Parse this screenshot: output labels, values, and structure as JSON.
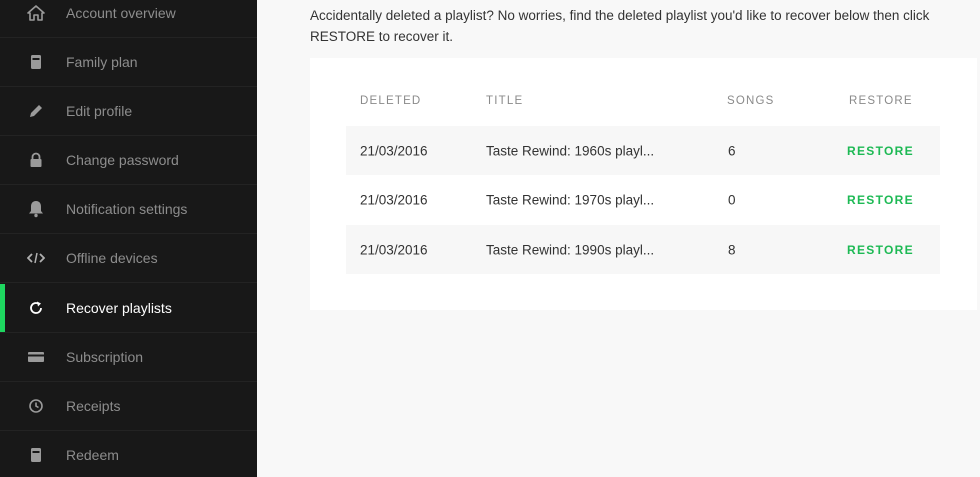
{
  "sidebar": {
    "items": [
      {
        "label": "Account overview",
        "icon": "home-icon"
      },
      {
        "label": "Family plan",
        "icon": "device-icon"
      },
      {
        "label": "Edit profile",
        "icon": "pencil-icon"
      },
      {
        "label": "Change password",
        "icon": "lock-icon"
      },
      {
        "label": "Notification settings",
        "icon": "bell-icon"
      },
      {
        "label": "Offline devices",
        "icon": "code-icon"
      },
      {
        "label": "Recover playlists",
        "icon": "refresh-icon",
        "active": true
      },
      {
        "label": "Subscription",
        "icon": "card-icon"
      },
      {
        "label": "Receipts",
        "icon": "clock-icon"
      },
      {
        "label": "Redeem",
        "icon": "device-icon"
      }
    ]
  },
  "main": {
    "intro": "Accidentally deleted a playlist? No worries, find the deleted playlist you'd like to recover below then click RESTORE to recover it.",
    "table": {
      "headers": [
        "DELETED",
        "TITLE",
        "SONGS",
        "RESTORE"
      ],
      "rows": [
        {
          "deleted": "21/03/2016",
          "title": "Taste Rewind: 1960s playl...",
          "songs": "6",
          "action": "RESTORE"
        },
        {
          "deleted": "21/03/2016",
          "title": "Taste Rewind: 1970s playl...",
          "songs": "0",
          "action": "RESTORE"
        },
        {
          "deleted": "21/03/2016",
          "title": "Taste Rewind: 1990s playl...",
          "songs": "8",
          "action": "RESTORE"
        }
      ]
    }
  },
  "colors": {
    "accent": "#1ed760",
    "restore": "#1db954",
    "sidebar_bg": "#181818",
    "page_bg": "#f8f8f8"
  }
}
